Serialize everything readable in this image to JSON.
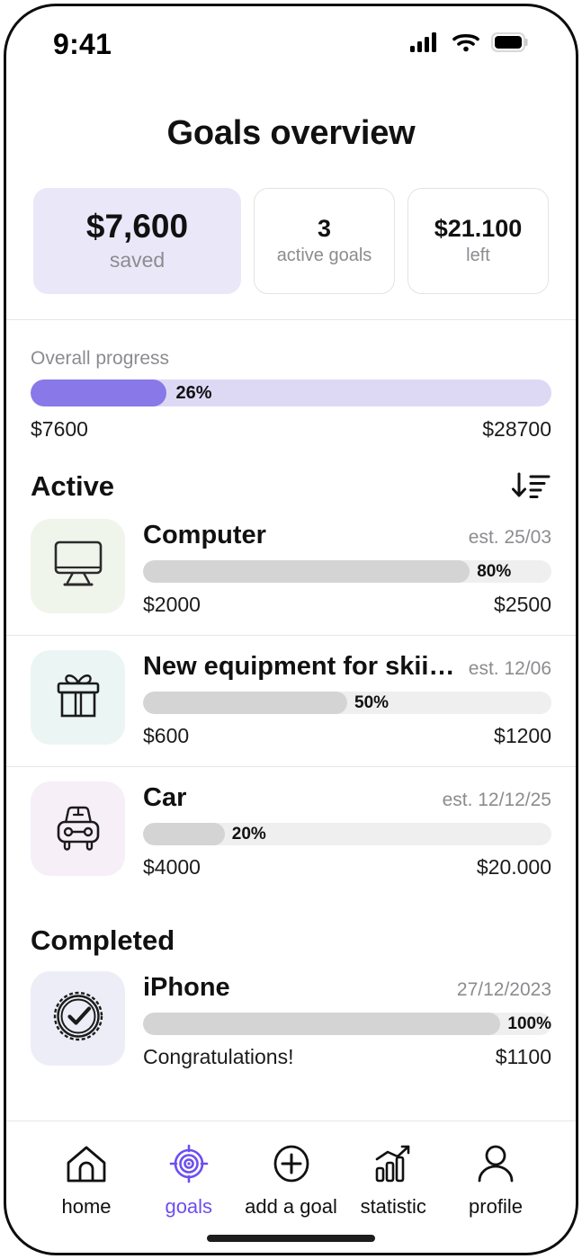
{
  "status_bar": {
    "time": "9:41",
    "icons": [
      "cellular-signal-icon",
      "wifi-icon",
      "battery-icon"
    ]
  },
  "header": {
    "title": "Goals overview"
  },
  "stats": [
    {
      "value": "$7,600",
      "label": "saved",
      "style": "primary"
    },
    {
      "value": "3",
      "label": "active goals",
      "style": "outline"
    },
    {
      "value": "$21.100",
      "label": "left",
      "style": "outline"
    }
  ],
  "overall_progress": {
    "label": "Overall progress",
    "percent_text": "26%",
    "percent": 26,
    "start": "$7600",
    "end": "$28700",
    "fill_color": "#8878e8",
    "track_color": "#ddd9f5"
  },
  "sections": {
    "active": {
      "title": "Active",
      "sort_icon": "sort-descending-icon"
    },
    "completed": {
      "title": "Completed"
    }
  },
  "active_goals": [
    {
      "name": "Computer",
      "date": "est. 25/03",
      "percent_text": "80%",
      "percent": 80,
      "saved": "$2000",
      "target": "$2500",
      "icon": "monitor-icon",
      "icon_bg": "#f0f5ec"
    },
    {
      "name": "New equipment for skiing",
      "date": "est. 12/06",
      "percent_text": "50%",
      "percent": 50,
      "saved": "$600",
      "target": "$1200",
      "icon": "gift-icon",
      "icon_bg": "#ebf5f3"
    },
    {
      "name": "Car",
      "date": "est. 12/12/25",
      "percent_text": "20%",
      "percent": 20,
      "saved": "$4000",
      "target": "$20.000",
      "icon": "car-icon",
      "icon_bg": "#f6eff8"
    }
  ],
  "completed_goals": [
    {
      "name": "iPhone",
      "date": "27/12/2023",
      "percent_text": "100%",
      "percent": 100,
      "saved": "Congratulations!",
      "target": "$1100",
      "icon": "check-badge-icon",
      "icon_bg": "#ededf8"
    }
  ],
  "bottom_nav": {
    "active_index": 1,
    "items": [
      {
        "label": "home",
        "icon": "home-icon"
      },
      {
        "label": "goals",
        "icon": "target-icon"
      },
      {
        "label": "add a goal",
        "icon": "plus-circle-icon"
      },
      {
        "label": "statistic",
        "icon": "bar-chart-icon"
      },
      {
        "label": "profile",
        "icon": "person-icon"
      }
    ]
  },
  "colors": {
    "accent": "#6c4ff0",
    "progress_fill": "#8878e8",
    "progress_track": "#ddd9f5",
    "goal_bar_fill": "#d4d4d4",
    "goal_bar_track": "#efefef"
  }
}
